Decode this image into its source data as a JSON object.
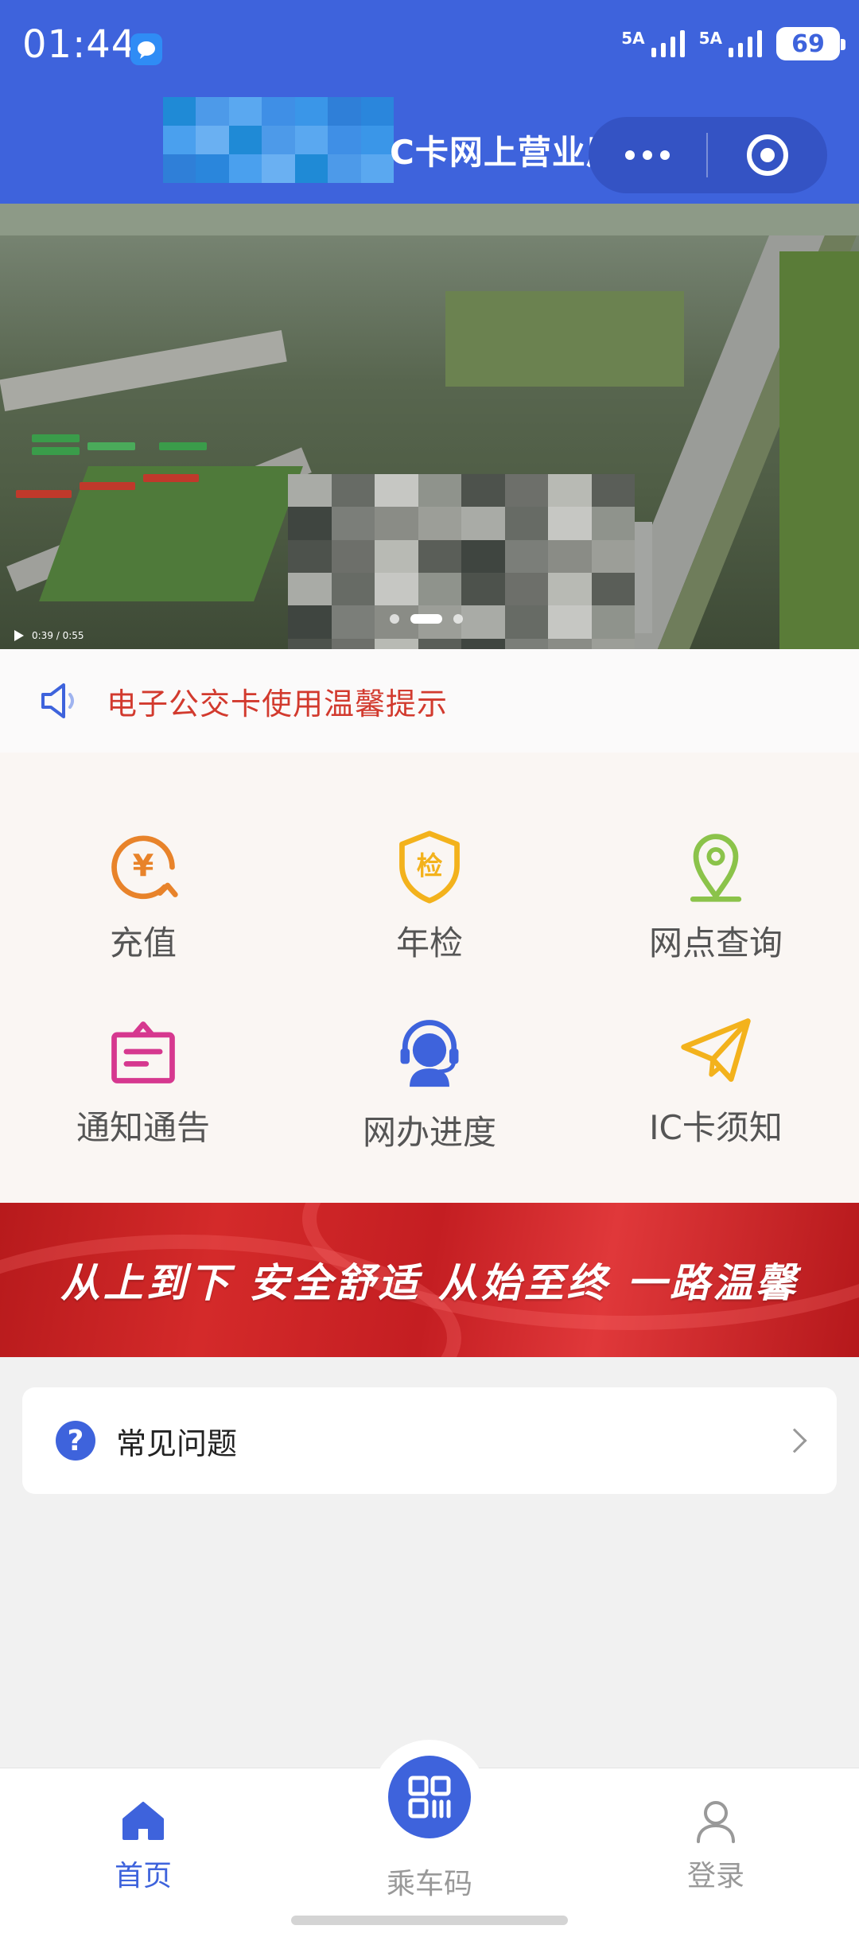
{
  "status_bar": {
    "time": "01:44",
    "signal_1_label": "5A",
    "signal_2_label": "5A",
    "battery": "69"
  },
  "title_bar": {
    "title": "C卡网上营业厅",
    "more_icon": "more-dots-icon",
    "close_icon": "target-icon"
  },
  "banner": {
    "video_time": "0:39 / 0:55",
    "slides": 3,
    "active_slide": 2
  },
  "notice": {
    "icon": "speaker-icon",
    "text": "电子公交卡使用温馨提示"
  },
  "services": [
    {
      "label": "充值",
      "icon": "yuan-recharge-icon",
      "color": "#e8832a"
    },
    {
      "label": "年检",
      "icon": "inspection-shield-icon",
      "color": "#f3b21c"
    },
    {
      "label": "网点查询",
      "icon": "location-pin-icon",
      "color": "#8bc34a"
    },
    {
      "label": "通知通告",
      "icon": "notice-board-icon",
      "color": "#d6388f"
    },
    {
      "label": "网办进度",
      "icon": "customer-service-icon",
      "color": "#3e63dc"
    },
    {
      "label": "IC卡须知",
      "icon": "paper-plane-icon",
      "color": "#f3b21c"
    }
  ],
  "slogan": {
    "text": "从上到下 安全舒适 从始至终 一路温馨"
  },
  "faq": {
    "label": "常见问题",
    "icon": "question-icon"
  },
  "bottom_nav": {
    "home_label": "首页",
    "ride_code_label": "乘车码",
    "login_label": "登录",
    "active_color": "#3e63dc",
    "inactive_color": "#999999"
  }
}
